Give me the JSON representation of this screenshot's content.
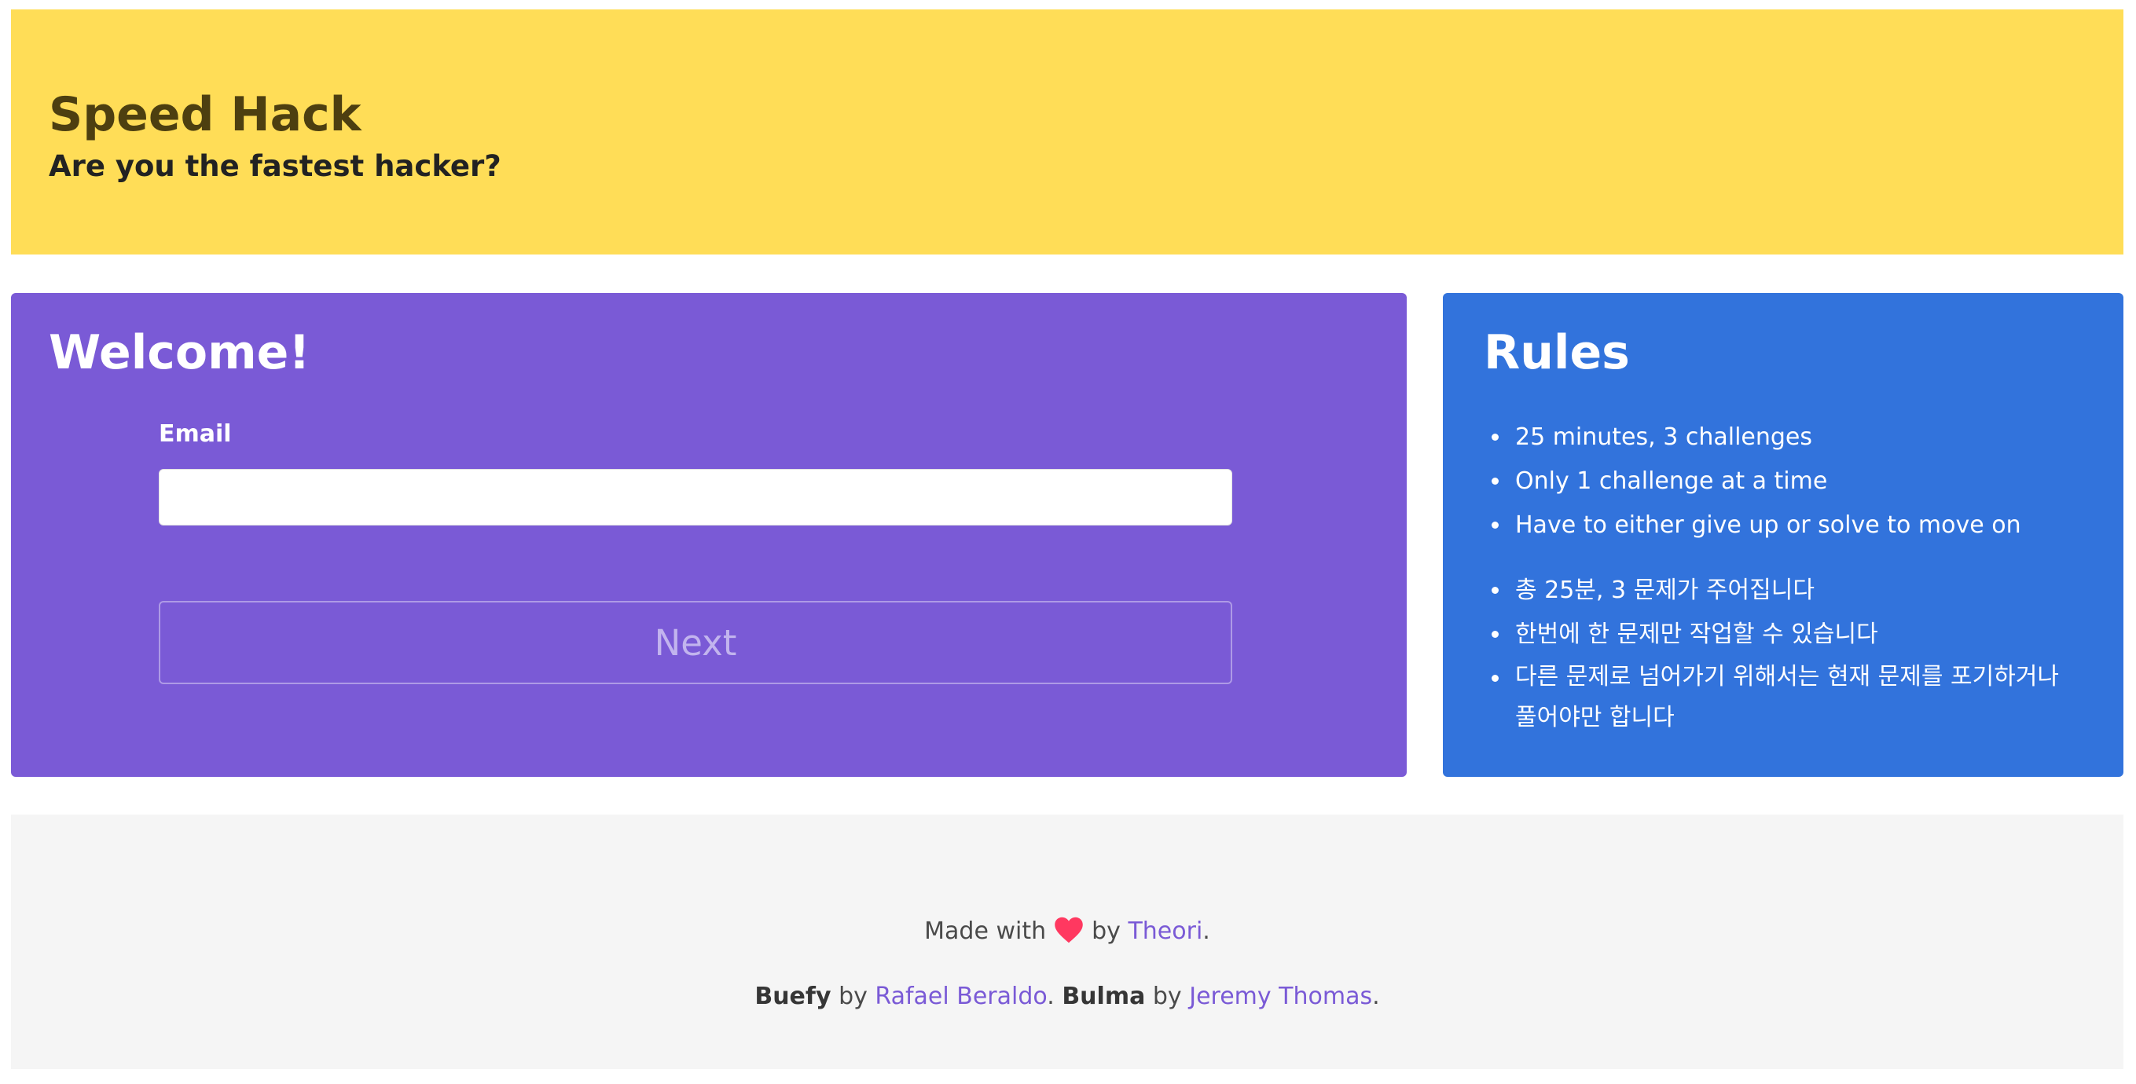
{
  "hero": {
    "title": "Speed Hack",
    "subtitle": "Are you the fastest hacker?"
  },
  "welcome": {
    "title": "Welcome!",
    "email_label": "Email",
    "email_value": "",
    "next_label": "Next"
  },
  "rules": {
    "title": "Rules",
    "english": [
      "25 minutes, 3 challenges",
      "Only 1 challenge at a time",
      "Have to either give up or solve to move on"
    ],
    "korean": [
      "총 25분, 3 문제가 주어집니다",
      "한번에 한 문제만 작업할 수 있습니다",
      "다른 문제로 넘어가기 위해서는 현재 문제를 포기하거나 풀어야만 합니다"
    ]
  },
  "footer": {
    "made_with": "Made with",
    "by1": "by",
    "theori": "Theori",
    "period1": ".",
    "buefy": "Buefy",
    "by2": "by",
    "rafael": "Rafael Beraldo",
    "period2": ".",
    "bulma": "Bulma",
    "by3": "by",
    "jeremy": "Jeremy Thomas",
    "period3": "."
  },
  "colors": {
    "hero_bg": "#ffdd57",
    "welcome_bg": "#7a5ad6",
    "rules_bg": "#3273dc",
    "footer_bg": "#f5f5f5",
    "heart": "#ff3860",
    "link": "#7a5ad6"
  },
  "icons": {
    "heart": "heart-icon"
  }
}
